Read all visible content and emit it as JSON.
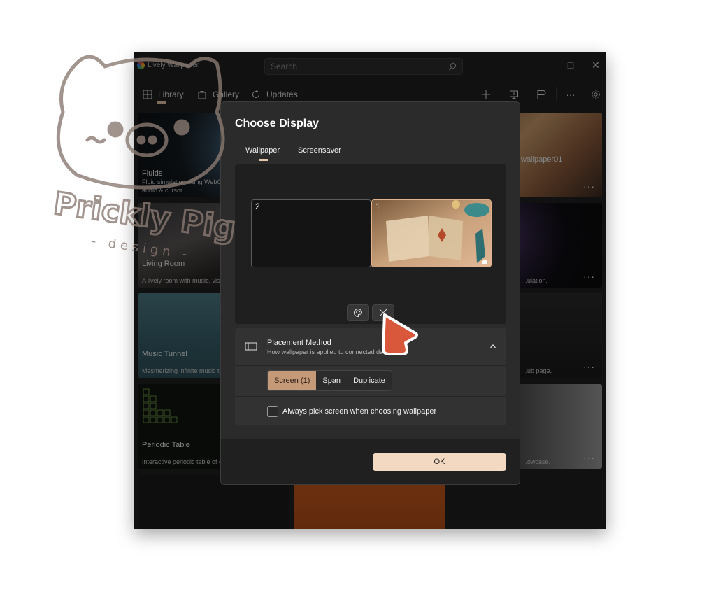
{
  "app": {
    "title": "Lively Wallpaper"
  },
  "search": {
    "placeholder": "Search"
  },
  "window_controls": {
    "minimize": "—",
    "maximize": "□",
    "close": "✕"
  },
  "nav": {
    "items": [
      {
        "label": "Library",
        "icon": "grid-icon"
      },
      {
        "label": "Gallery",
        "icon": "bag-icon"
      },
      {
        "label": "Updates",
        "icon": "refresh-icon"
      }
    ],
    "tools": [
      "plus-icon",
      "monitor-icon",
      "flag-icon",
      "more-icon",
      "gear-icon"
    ],
    "more_label": "···"
  },
  "library": {
    "cards": [
      {
        "title": "Fluids",
        "desc": "Fluid simulation using WebGL, reacts to system audio & cursor."
      },
      {
        "title": "Living Room",
        "desc": "A lively room with music, visualizer and more!"
      },
      {
        "title": "Music Tunnel",
        "desc": "Mesmerizing infinite music tunnel."
      },
      {
        "title": "Periodic Table",
        "desc": "Interactive periodic table of elements."
      },
      {
        "title": "wallpaper01",
        "desc": ""
      },
      {
        "title": "",
        "desc": "…ulation."
      },
      {
        "title": "",
        "desc": "…ub page."
      },
      {
        "title": "",
        "desc": "…owcase."
      }
    ],
    "more_label": "···"
  },
  "dialog": {
    "title": "Choose Display",
    "tabs": [
      "Wallpaper",
      "Screensaver"
    ],
    "active_tab": "Wallpaper",
    "monitors": [
      {
        "number": "2",
        "has_wallpaper": false
      },
      {
        "number": "1",
        "has_wallpaper": true
      }
    ],
    "actions": [
      "palette-icon",
      "close-icon"
    ],
    "placement": {
      "title": "Placement Method",
      "desc": "How wallpaper is applied to connected devices",
      "modes": [
        "Screen (1)",
        "Span",
        "Duplicate"
      ],
      "active_mode": "Screen (1)",
      "checkbox_label": "Always pick screen when choosing wallpaper",
      "checkbox_checked": false
    },
    "ok_label": "OK"
  },
  "watermark": {
    "line1": "Prickly Pig",
    "line2": "- design -"
  },
  "colors": {
    "accent": "#f3d8c2",
    "active_mode": "#c59a79",
    "cursor": "#d9573a"
  }
}
